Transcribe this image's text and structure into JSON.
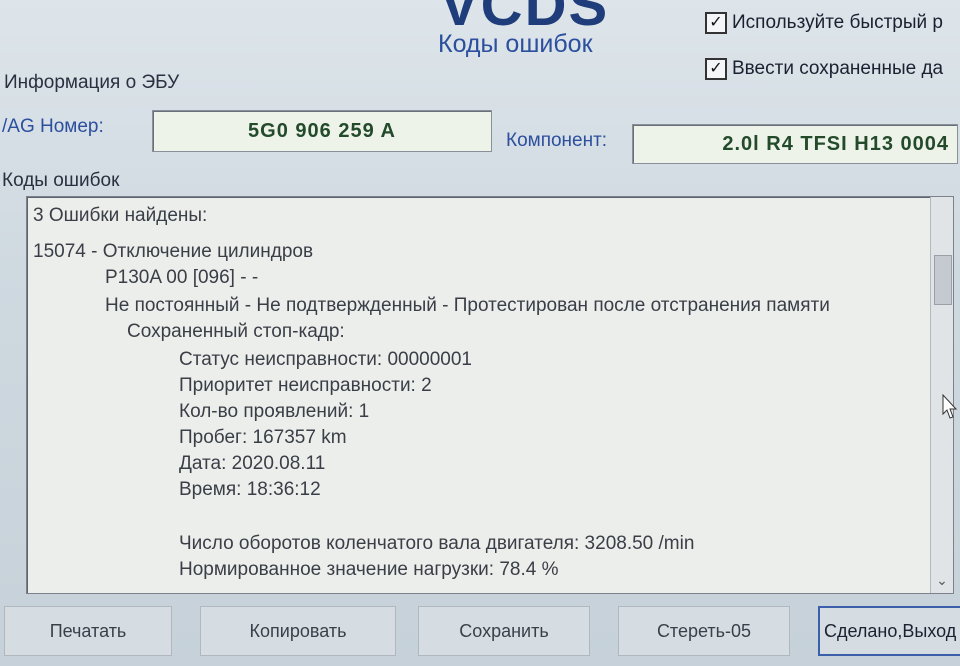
{
  "header": {
    "logo_text": "VCDS",
    "window_title": "Коды ошибок"
  },
  "options": {
    "fast_mode": {
      "label": "Используйте быстрый р",
      "checked": true
    },
    "enter_saved": {
      "label": "Ввести сохраненные да",
      "checked": true
    }
  },
  "ecu_info": {
    "section_label": "Информация о ЭБУ",
    "vag_label": "/AG Номер:",
    "vag_value": "5G0 906 259 A",
    "component_label": "Компонент:",
    "component_value": "2.0l R4 TFSI  H13 0004"
  },
  "codes": {
    "section_label": "Коды ошибок",
    "lines": [
      "3 Ошибки найдены:",
      "15074 - Отключение цилиндров",
      "P130A 00 [096] - -",
      "Не постоянный - Не подтвержденный - Протестирован после отстранения памяти",
      "Сохраненный стоп-кадр:",
      "Статус неисправности: 00000001",
      "Приоритет неисправности: 2",
      "Кол-во проявлений: 1",
      "Пробег: 167357 km",
      "Дата: 2020.08.11",
      "Время: 18:36:12",
      "",
      "Число оборотов коленчатого вала двигателя: 3208.50 /min",
      "Нормированное значение нагрузки: 78.4 %"
    ]
  },
  "buttons": {
    "print": "Печатать",
    "copy": "Копировать",
    "save": "Сохранить",
    "clear": "Стереть-05",
    "done": "Сделано,Выход"
  },
  "icons": {
    "checkbox_checked": "check-icon",
    "scroll_down": "chevron-down-icon",
    "cursor": "mouse-cursor-icon"
  }
}
